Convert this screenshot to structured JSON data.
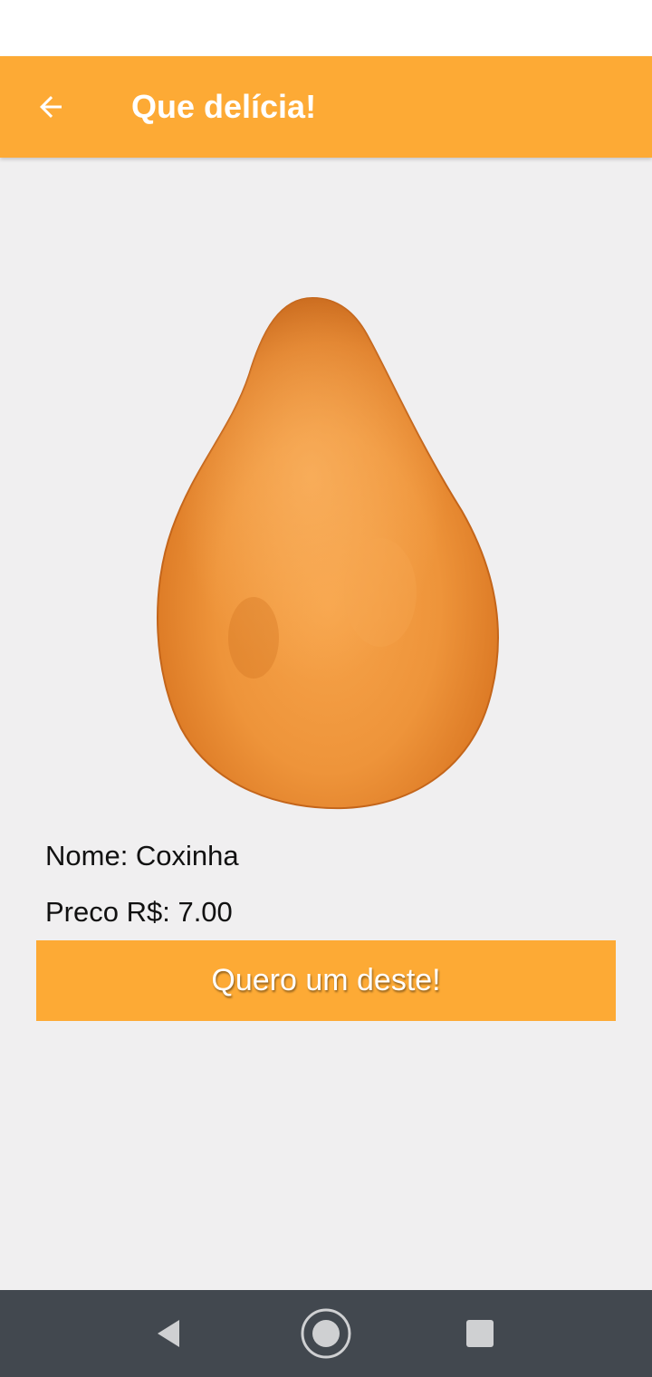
{
  "app_bar": {
    "title": "Que delícia!",
    "back_icon": "arrow-left-icon",
    "color": "#fdaa35"
  },
  "product": {
    "image_icon": "coxinha-image",
    "name_label": "Nome: Coxinha",
    "price_label": "Preco R$: 7.00"
  },
  "actions": {
    "order_label": "Quero um deste!"
  },
  "nav": {
    "back_icon": "triangle-back-icon",
    "home_icon": "circle-home-icon",
    "recents_icon": "square-recents-icon"
  }
}
